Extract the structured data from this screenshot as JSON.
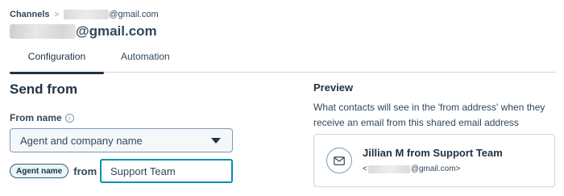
{
  "breadcrumb": {
    "root_label": "Channels",
    "separator": ">",
    "current_suffix": "@gmail.com"
  },
  "page_title": {
    "suffix": "@gmail.com"
  },
  "tabs": [
    {
      "label": "Configuration",
      "active": true
    },
    {
      "label": "Automation",
      "active": false
    }
  ],
  "send_from": {
    "heading": "Send from",
    "from_name_label": "From name",
    "info_icon": "info-circle-icon",
    "select_value": "Agent and company name",
    "agent_token": "Agent name",
    "from_word": "from",
    "team_input_value": "Support Team"
  },
  "preview": {
    "heading": "Preview",
    "description": "What contacts will see in the 'from address' when they receive an email from this shared email address",
    "sender_name": "Jillian M from Support Team",
    "email_prefix": "<",
    "email_suffix": "@gmail.com>",
    "avatar_icon": "envelope-icon"
  },
  "colors": {
    "text": "#33475b",
    "heading": "#213343",
    "focus_border": "#0091ae",
    "border": "#cbd6e2"
  }
}
